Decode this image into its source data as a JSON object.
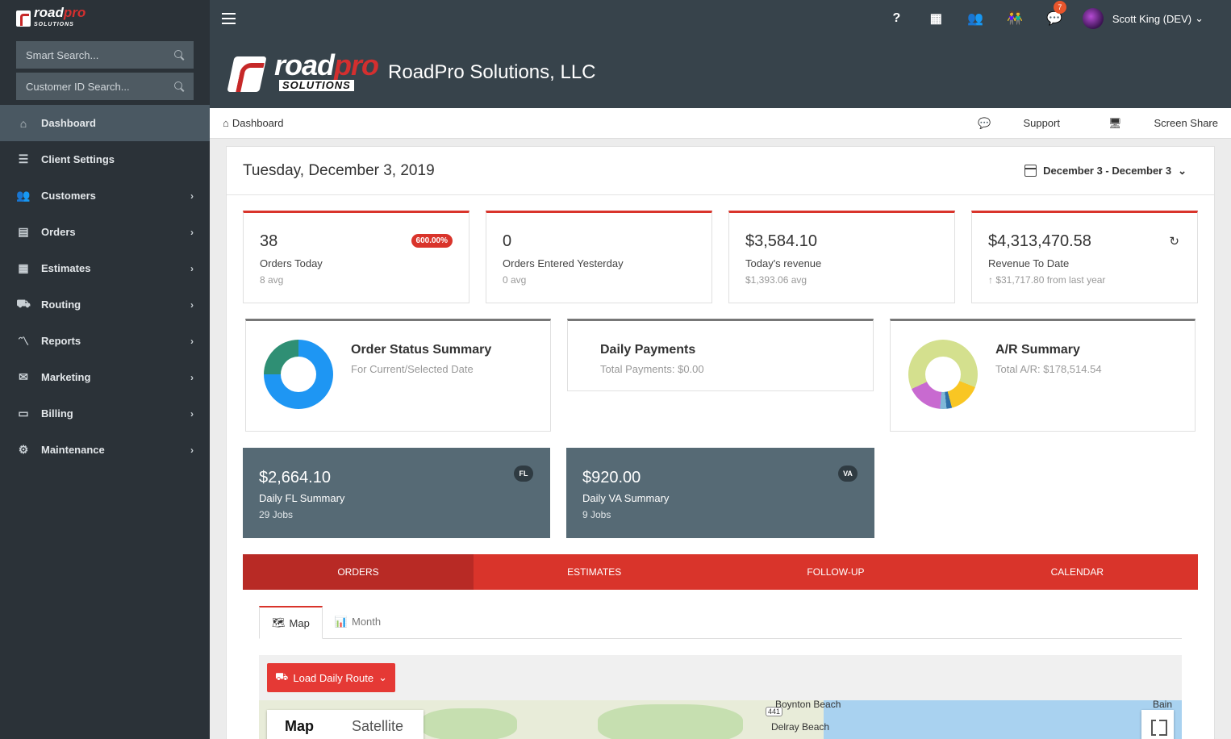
{
  "sidebar": {
    "logo_word_main": "road",
    "logo_word_accent": "pro",
    "logo_sub": "SOLUTIONS",
    "smart_search_placeholder": "Smart Search...",
    "customer_search_placeholder": "Customer ID Search...",
    "items": [
      {
        "label": "Dashboard",
        "icon": "home-icon",
        "glyph": "⌂"
      },
      {
        "label": "Client Settings",
        "icon": "sliders-icon",
        "glyph": "☰"
      },
      {
        "label": "Customers",
        "icon": "users-icon",
        "glyph": "👥"
      },
      {
        "label": "Orders",
        "icon": "orders-icon",
        "glyph": "▤"
      },
      {
        "label": "Estimates",
        "icon": "clipboard-icon",
        "glyph": "▦"
      },
      {
        "label": "Routing",
        "icon": "truck-icon",
        "glyph": "⛟"
      },
      {
        "label": "Reports",
        "icon": "chart-line-icon",
        "glyph": "〽"
      },
      {
        "label": "Marketing",
        "icon": "envelope-icon",
        "glyph": "✉"
      },
      {
        "label": "Billing",
        "icon": "credit-card-icon",
        "glyph": "▭"
      },
      {
        "label": "Maintenance",
        "icon": "gear-icon",
        "glyph": "⚙"
      }
    ],
    "chevron": "›"
  },
  "topbar": {
    "help_glyph": "?",
    "calendar_glyph": "▦",
    "team_glyph": "👥",
    "people_glyph": "👫",
    "chat_glyph": "💬",
    "notification_count": "7",
    "user_name": "Scott King (DEV)",
    "caret": "⌄"
  },
  "banner": {
    "logo_main": "road",
    "logo_accent": "pro",
    "logo_sub": "SOLUTIONS",
    "company": "RoadPro Solutions, LLC"
  },
  "breadcrumb": {
    "home_glyph": "⌂",
    "current": "Dashboard",
    "support": "Support",
    "support_glyph": "💬",
    "screen_share": "Screen Share",
    "screen_glyph": "🖥"
  },
  "header": {
    "date": "Tuesday, December 3, 2019",
    "range": "December 3 - December 3",
    "caret": "⌄"
  },
  "stats": [
    {
      "value": "38",
      "label": "Orders Today",
      "sub": "8 avg",
      "badge": "600.00%"
    },
    {
      "value": "0",
      "label": "Orders Entered Yesterday",
      "sub": "0 avg"
    },
    {
      "value": "$3,584.10",
      "label": "Today's revenue",
      "sub": "$1,393.06 avg"
    },
    {
      "value": "$4,313,470.58",
      "label": "Revenue To Date",
      "sub": "↑ $31,717.80 from last year",
      "refresh_glyph": "↻"
    }
  ],
  "summaries": {
    "order_status": {
      "title": "Order Status Summary",
      "subtitle": "For Current/Selected Date",
      "colors": [
        "#1e96f3",
        "#2f8f74"
      ],
      "share": [
        0.75,
        0.25
      ]
    },
    "daily_payments": {
      "title": "Daily Payments",
      "subtitle": "Total Payments: $0.00"
    },
    "ar": {
      "title": "A/R Summary",
      "subtitle": "Total A/R: $178,514.54",
      "colors": [
        "#d4e08e",
        "#f9c623",
        "#2f6fa8",
        "#7fb8d8",
        "#c86ad0"
      ]
    }
  },
  "state_summaries": [
    {
      "value": "$2,664.10",
      "label": "Daily FL Summary",
      "sub": "29 Jobs",
      "tag": "FL"
    },
    {
      "value": "$920.00",
      "label": "Daily VA Summary",
      "sub": "9 Jobs",
      "tag": "VA"
    }
  ],
  "tabs": [
    "ORDERS",
    "ESTIMATES",
    "FOLLOW-UP",
    "CALENDAR"
  ],
  "subtabs": [
    {
      "label": "Map",
      "glyph": "🗺"
    },
    {
      "label": "Month",
      "glyph": "📊"
    }
  ],
  "map": {
    "load_button": "Load Daily Route",
    "truck_glyph": "⛟",
    "caret": "⌄",
    "toggle_map": "Map",
    "toggle_satellite": "Satellite",
    "city_1": "Boynton Beach",
    "city_2": "Delray Beach",
    "city_3": "Bain",
    "highway": "441"
  },
  "colors": {
    "accent": "#d9342b",
    "sidebar": "#2b3238",
    "topbar": "#37434b",
    "state_card": "#566a75"
  }
}
